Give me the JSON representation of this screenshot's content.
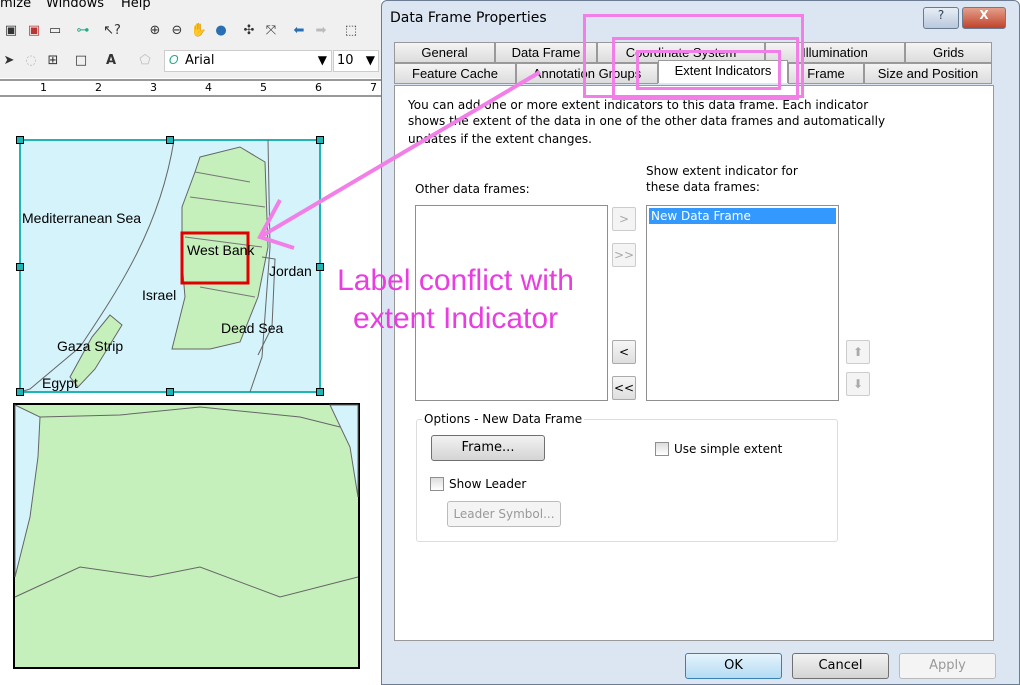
{
  "app": {
    "menu": [
      "mize",
      "Windows",
      "Help"
    ],
    "font_name": "Arial",
    "font_size": "10",
    "ruler_ticks": [
      "1",
      "2",
      "3",
      "4",
      "5",
      "6",
      "7"
    ]
  },
  "map": {
    "labels": {
      "sea": "Mediterranean Sea",
      "west_bank": "West Bank",
      "jordan": "Jordan",
      "israel": "Israel",
      "dead_sea": "Dead Sea",
      "gaza": "Gaza Strip",
      "egypt": "Egypt"
    },
    "colors": {
      "water": "#d4f3fb",
      "land": "#c5efbb",
      "extent": "#e00000",
      "selection": "#1fb5b5"
    }
  },
  "annotation": {
    "line1": "Label conflict with",
    "line2": "extent Indicator",
    "color": "#e83ee0"
  },
  "dialog": {
    "title": "Data Frame Properties",
    "help": "?",
    "close": "X",
    "tabs_row1": [
      "General",
      "Data Frame",
      "Coordinate System",
      "Illumination",
      "Grids"
    ],
    "tabs_row2": [
      "Feature Cache",
      "Annotation Groups",
      "Extent Indicators",
      "Frame",
      "Size and Position"
    ],
    "active_tab": "Extent Indicators",
    "description": [
      "You can add one or more extent indicators to this data frame. Each indicator",
      "shows the extent of the data in one of the other data frames and automatically",
      "updates if the extent changes."
    ],
    "other_label": "Other data frames:",
    "show_label": [
      "Show extent indicator for",
      "these data frames:"
    ],
    "other_items": [],
    "show_items": [
      "New Data Frame"
    ],
    "move": {
      "add": ">",
      "add_all": ">>",
      "remove": "<",
      "remove_all": "<<"
    },
    "options": {
      "legend": "Options - New Data Frame",
      "frame_btn": "Frame...",
      "simple_extent": "Use simple extent",
      "simple_extent_checked": false,
      "show_leader": "Show Leader",
      "show_leader_checked": false,
      "leader_symbol": "Leader Symbol..."
    },
    "ok": "OK",
    "cancel": "Cancel",
    "apply": "Apply"
  }
}
